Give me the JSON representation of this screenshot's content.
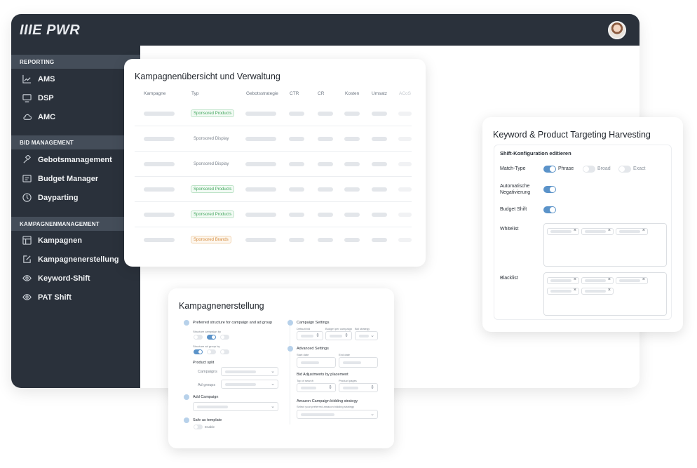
{
  "app": {
    "logo": "IIIE PWR"
  },
  "sidebar": {
    "sections": [
      {
        "title": "REPORTING",
        "items": [
          {
            "label": "AMS",
            "icon": "chart-line-icon"
          },
          {
            "label": "DSP",
            "icon": "monitor-icon"
          },
          {
            "label": "AMC",
            "icon": "cloud-icon"
          }
        ]
      },
      {
        "title": "BID MANAGEMENT",
        "items": [
          {
            "label": "Gebotsmanagement",
            "icon": "gavel-icon"
          },
          {
            "label": "Budget Manager",
            "icon": "wallet-icon"
          },
          {
            "label": "Dayparting",
            "icon": "clock-icon"
          }
        ]
      },
      {
        "title": "KAMPAGNENMANAGEMENT",
        "items": [
          {
            "label": "Kampagnen",
            "icon": "layout-icon"
          },
          {
            "label": "Kampagnenerstellung",
            "icon": "edit-icon"
          },
          {
            "label": "Keyword-Shift",
            "icon": "eye-icon"
          },
          {
            "label": "PAT Shift",
            "icon": "eye-icon"
          }
        ]
      }
    ]
  },
  "overview": {
    "title": "Kampagnenübersicht und Verwaltung",
    "columns": [
      "Kampagne",
      "Typ",
      "Gebotsstrategie",
      "CTR",
      "CR",
      "Kosten",
      "Umsatz",
      "ACoS"
    ],
    "rows": [
      {
        "type": "Sponsored Products",
        "style": "green"
      },
      {
        "type": "Sponsored Display",
        "style": "grey"
      },
      {
        "type": "Sponsored Display",
        "style": "grey"
      },
      {
        "type": "Sponsored Products",
        "style": "green"
      },
      {
        "type": "Sponsored Products",
        "style": "green"
      },
      {
        "type": "Sponsored Brands",
        "style": "orange"
      }
    ]
  },
  "targeting": {
    "title": "Keyword & Product Targeting Harvesting",
    "subtitle": "Shift-Konfiguration editieren",
    "match_type_label": "Match-Type",
    "match_options": [
      "Phrase",
      "Broad",
      "Exact"
    ],
    "auto_neg_label_1": "Automatische",
    "auto_neg_label_2": "Negativierung",
    "budget_shift_label": "Budget Shift",
    "whitelist_label": "Whitelist",
    "blacklist_label": "Blacklist"
  },
  "creation": {
    "title": "Kampagnenerstellung",
    "preferred_structure": "Preferred structure for campaign and ad group",
    "structure_campaign_by": "Structure campaign by",
    "structure_adgroup_by": "Structure ad group by",
    "product_split": "Product split",
    "campaigns_label": "Campaigns",
    "adgroups_label": "Ad groups",
    "add_campaign": "Add Campaign",
    "safe_as_template": "Safe as template",
    "enable": "Enable",
    "campaign_settings": "Campaign Settings",
    "default_bid": "Default bid",
    "budget_per_campaign": "Budget per campaign",
    "bid_strategy": "Bid strategy",
    "advanced_settings": "Advanced Settings",
    "start_date": "Start date",
    "end_date": "End date",
    "bid_adjustments": "Bid Adjustments by placement",
    "top_of_search": "Top of search",
    "product_pages": "Product pages",
    "bidding_strategy": "Amazon Campaign bidding strategy",
    "bidding_strategy_hint": "Select your preferred amazon bidding strategy"
  },
  "colors": {
    "sidebar_bg": "#2a313b",
    "section_bg": "#444d59",
    "accent": "#5b93c9"
  }
}
